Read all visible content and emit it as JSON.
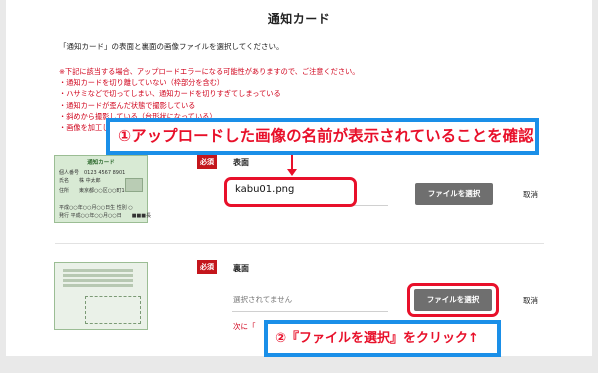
{
  "page": {
    "title": "通知カード",
    "intro": "「通知カード」の表面と裏面の画像ファイルを選択してください。"
  },
  "notes": [
    "※下記に該当する場合、アップロードエラーになる可能性がありますので、ご注意ください。",
    "・通知カードを切り離していない（枠部分を含む）",
    "・ハサミなどで切ってしまい、通知カードを切りすぎてしまっている",
    "・通知カードが歪んだ状態で撮影している",
    "・斜めから撮影している（台形状になっている）",
    "・画像を加工している"
  ],
  "front": {
    "required_badge": "必須",
    "label": "表面",
    "file_name": "kabu01.png",
    "select_button": "ファイルを選択",
    "cancel": "取消",
    "thumbnail": {
      "title": "通知カード",
      "rows": [
        "個人番号　0123 4567 8901",
        "氏名　　株 中太郎",
        "住所　　東京都○○区○○町1-2-3",
        "平成○○年○○月○○日生 性別 ○",
        "発行 平成○○年○○月○○日　　■■■長"
      ]
    }
  },
  "back": {
    "required_badge": "必須",
    "label": "裏面",
    "file_status": "選択されてません",
    "select_button": "ファイルを選択",
    "cancel": "取消",
    "next_text": "次に「"
  },
  "annotations": {
    "callout1": "①アップロードした画像の名前が表示されていることを確認",
    "callout2": "②『ファイルを選択』をクリック↑"
  },
  "colors": {
    "required": "#c4161c",
    "note_text": "#d0021b",
    "highlight_red": "#e8102a",
    "callout_border": "#1a8fe8",
    "button": "#6f6f6f"
  }
}
